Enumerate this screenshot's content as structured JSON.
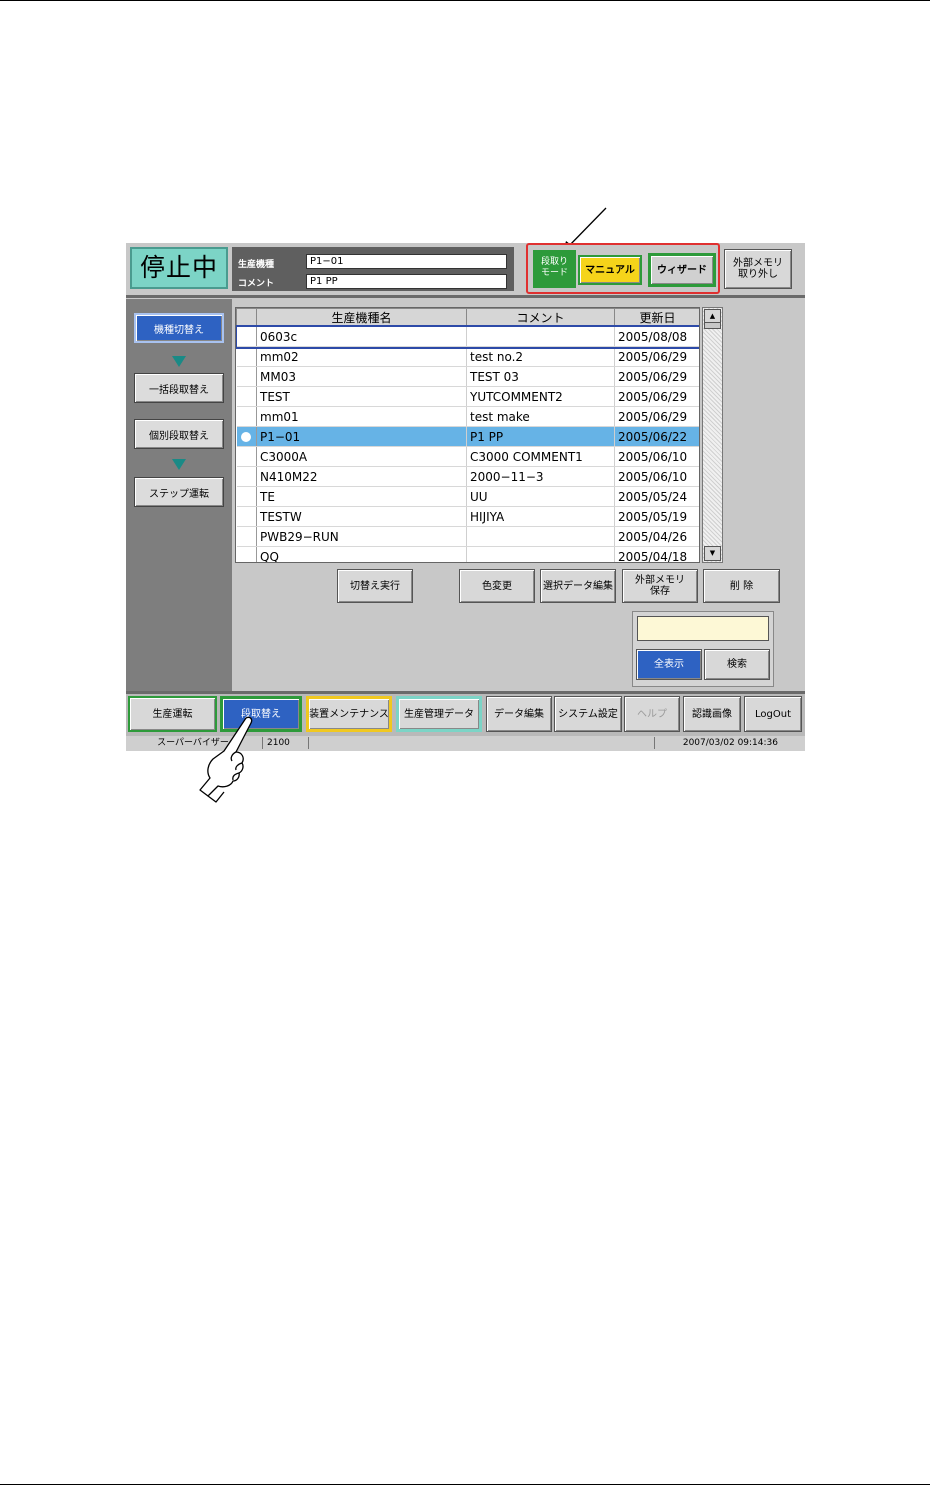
{
  "status": "停止中",
  "info": {
    "model_label": "生産機種",
    "model_value": "P1−01",
    "comment_label": "コメント",
    "comment_value": "P1 PP"
  },
  "mode": {
    "label": "段取り\nモード",
    "manual": "マニュアル",
    "wizard": "ウィザード",
    "external": "外部メモリ\n取り外し"
  },
  "sidebar": {
    "items": [
      {
        "label": "機種切替え",
        "active": true
      },
      {
        "label": "一括段取替え",
        "active": false
      },
      {
        "label": "個別段取替え",
        "active": false
      },
      {
        "label": "ステップ運転",
        "active": false
      }
    ]
  },
  "table": {
    "headers": [
      "生産機種名",
      "コメント",
      "更新日"
    ],
    "rows": [
      {
        "name": "0603c",
        "comment": "",
        "date": "2005/08/08",
        "selected": false
      },
      {
        "name": "mm02",
        "comment": "test no.2",
        "date": "2005/06/29",
        "selected": false
      },
      {
        "name": "MM03",
        "comment": "TEST 03",
        "date": "2005/06/29",
        "selected": false
      },
      {
        "name": "TEST",
        "comment": "YUTCOMMENT2",
        "date": "2005/06/29",
        "selected": false
      },
      {
        "name": "mm01",
        "comment": "test make",
        "date": "2005/06/29",
        "selected": false
      },
      {
        "name": "P1−01",
        "comment": "P1 PP",
        "date": "2005/06/22",
        "selected": true
      },
      {
        "name": "C3000A",
        "comment": "C3000 COMMENT1",
        "date": "2005/06/10",
        "selected": false
      },
      {
        "name": "N410M22",
        "comment": "2000−11−3",
        "date": "2005/06/10",
        "selected": false
      },
      {
        "name": "TE",
        "comment": "UU",
        "date": "2005/05/24",
        "selected": false
      },
      {
        "name": "TESTW",
        "comment": "HIJIYA",
        "date": "2005/05/19",
        "selected": false
      },
      {
        "name": "PWB29−RUN",
        "comment": "",
        "date": "2005/04/26",
        "selected": false
      },
      {
        "name": "QQ",
        "comment": "",
        "date": "2005/04/18",
        "selected": false
      }
    ]
  },
  "actions": {
    "switch_exec": "切替え実行",
    "color_change": "色変更",
    "edit_selected": "選択データ編集",
    "ext_save": "外部メモリ\n保存",
    "delete": "削 除",
    "show_all": "全表示",
    "search": "検索",
    "search_value": ""
  },
  "bottom_menu": {
    "items": [
      {
        "label": "生産運転",
        "id": "production"
      },
      {
        "label": "段取替え",
        "id": "setup"
      },
      {
        "label": "装置メンテナンス",
        "id": "maintenance"
      },
      {
        "label": "生産管理データ",
        "id": "prod-data"
      },
      {
        "label": "データ編集",
        "id": "data-edit"
      },
      {
        "label": "システム設定",
        "id": "system"
      },
      {
        "label": "ヘルプ",
        "id": "help"
      },
      {
        "label": "認識画像",
        "id": "recog"
      },
      {
        "label": "LogOut",
        "id": "logout"
      }
    ]
  },
  "statusbar": {
    "user": "スーパーバイザー",
    "code": "2100",
    "datetime": "2007/03/02  09:14:36"
  },
  "colors": {
    "status_bg": "#7cd4c6",
    "mode_green": "#2d9a3a",
    "manual_yellow": "#f5d41a",
    "selected_row": "#66b3e6",
    "active_blue": "#2e62c2",
    "highlight_red": "#e03030"
  },
  "icons": {
    "pointer": "pointing-hand-icon",
    "arrow": "annotation-arrow-icon"
  }
}
